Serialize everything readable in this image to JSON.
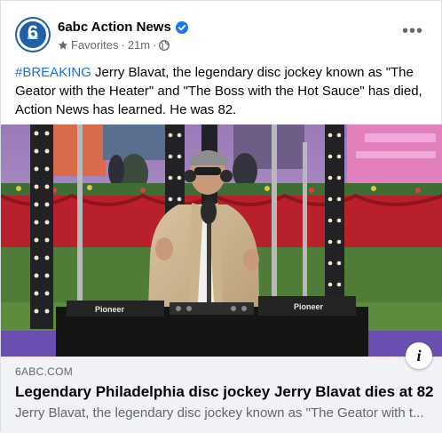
{
  "post": {
    "page_name": "6abc Action News",
    "audience": "Favorites",
    "time": "21m",
    "separator": "·",
    "hashtag": "#BREAKING",
    "body": " Jerry Blavat, the legendary disc jockey known as \"The Geator with the Heater\" and \"The Boss with the Hot Sauce\" has died, Action News has learned. He was 82.",
    "more_label": "•••"
  },
  "avatar": {
    "number": "6",
    "letters": "abc"
  },
  "photo": {
    "console_brand_left": "Pioneer",
    "console_brand_right": "Pioneer"
  },
  "link": {
    "domain": "6ABC.COM",
    "title": "Legendary Philadelphia disc jockey Jerry Blavat dies at 82",
    "description": "Jerry Blavat, the legendary disc jockey known as \"The Geator with t...",
    "info_label": "i"
  },
  "colors": {
    "link_blue": "#216fdb",
    "verified_blue": "#1877f2",
    "brand_blue": "#1f5fa8"
  }
}
